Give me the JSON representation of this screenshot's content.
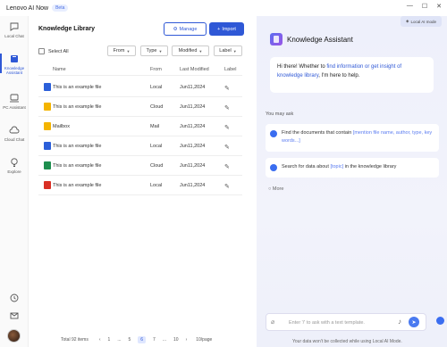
{
  "app": {
    "title": "Lenovo AI Now",
    "badge": "Beta"
  },
  "window": {
    "minimize": "—",
    "maximize": "☐",
    "close": "✕"
  },
  "nav": {
    "items": [
      {
        "label": "Local Chat",
        "icon": "chat-bubble-icon",
        "active": false
      },
      {
        "label": "Knowledge Assistant",
        "icon": "book-icon",
        "active": true
      },
      {
        "label": "PC Assistant",
        "icon": "laptop-icon",
        "active": false
      },
      {
        "label": "Cloud Chat",
        "icon": "cloud-icon",
        "active": false
      },
      {
        "label": "Explore",
        "icon": "bulb-icon",
        "active": false
      }
    ],
    "bottom_icons": [
      "history-icon",
      "mail-icon"
    ]
  },
  "library": {
    "title": "Knowledge Library",
    "manage_label": "Manage",
    "import_label": "Import",
    "select_all": "Select All",
    "filters": [
      "From",
      "Type",
      "Modified",
      "Label"
    ],
    "columns": {
      "name": "Name",
      "from": "From",
      "modified": "Last Modified",
      "label": "Label"
    },
    "rows": [
      {
        "name": "This is an example file",
        "from": "Local",
        "modified": "Jun11,2024",
        "type_icon": "word-doc-icon",
        "color": "#2b5fd9"
      },
      {
        "name": "This is an example file",
        "from": "Cloud",
        "modified": "Jun11,2024",
        "type_icon": "folder-icon",
        "color": "#f4b400"
      },
      {
        "name": "Mailbox",
        "from": "Mail",
        "modified": "Jun11,2024",
        "type_icon": "folder-icon",
        "color": "#f4b400"
      },
      {
        "name": "This is an example file",
        "from": "Local",
        "modified": "Jun11,2024",
        "type_icon": "word-doc-icon",
        "color": "#2b5fd9"
      },
      {
        "name": "This is an example file",
        "from": "Cloud",
        "modified": "Jun11,2024",
        "type_icon": "excel-doc-icon",
        "color": "#1e8e4e"
      },
      {
        "name": "This is an example file",
        "from": "Local",
        "modified": "Jun11,2024",
        "type_icon": "pdf-doc-icon",
        "color": "#d93025"
      }
    ],
    "pager": {
      "total": "Total 92 items",
      "prev": "‹",
      "pages": [
        "1",
        "...",
        "5",
        "6",
        "7",
        "...",
        "10"
      ],
      "active_page": "6",
      "next": "›",
      "per_page": "10/page"
    }
  },
  "assistant": {
    "mode_badge": "Local AI mode",
    "title": "Knowledge Assistant",
    "greeting_pre": "Hi there! Whether to ",
    "greeting_link": "find information or get insight of knowledge library",
    "greeting_post": ", I'm here to help.",
    "you_may_ask": "You may ask",
    "suggestions": [
      {
        "pre": "Find the documents that contain ",
        "placeholder": "[mention file name, author, type, key words...]",
        "post": ""
      },
      {
        "pre": "Search for data about ",
        "placeholder": "[topic]",
        "post": " in the knowledge library"
      }
    ],
    "more": "More",
    "input_placeholder": "Enter '/' to ask with a text template.",
    "note": "Your data won't be collected while using  Local AI Mode."
  }
}
